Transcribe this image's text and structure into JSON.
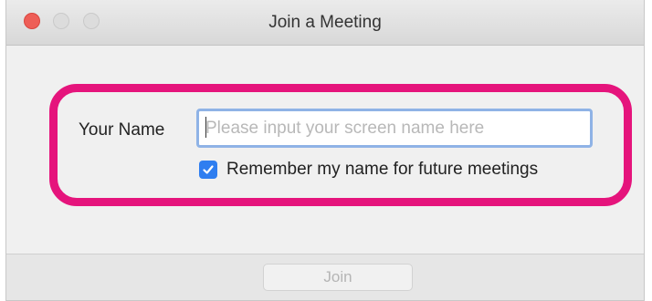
{
  "window": {
    "title": "Join a Meeting"
  },
  "form": {
    "name_label": "Your Name",
    "name_placeholder": "Please input your screen name here",
    "name_value": "",
    "remember_checked": true,
    "remember_label": "Remember my name for future meetings"
  },
  "footer": {
    "join_label": "Join",
    "join_enabled": false
  },
  "colors": {
    "highlight": "#e5147c",
    "checkbox": "#2f7ef0",
    "input_focus": "#8fb3e6",
    "close_button": "#ee5e57"
  },
  "icons": [
    "close-button-icon",
    "minimize-button-icon",
    "zoom-button-icon",
    "checkmark-icon"
  ]
}
